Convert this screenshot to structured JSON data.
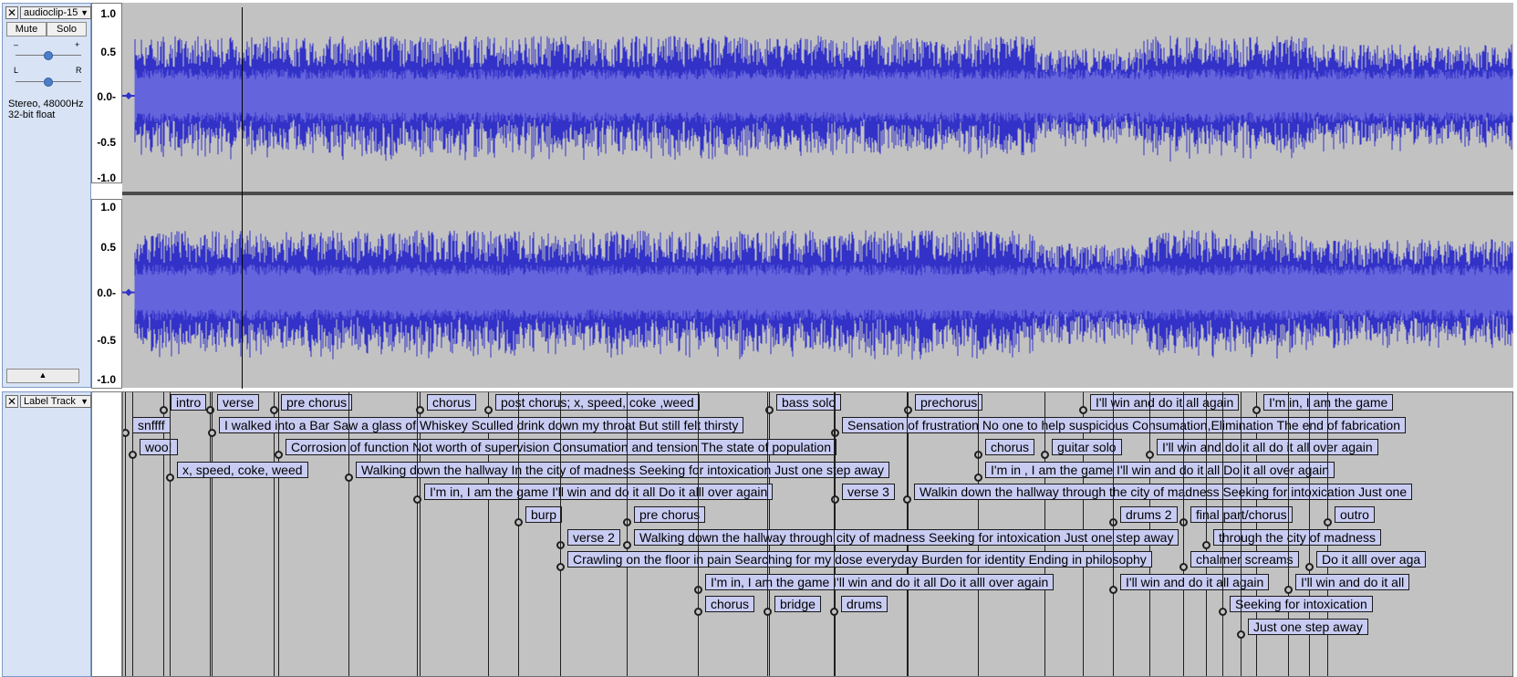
{
  "audio_track": {
    "name": "audioclip-15",
    "mute_label": "Mute",
    "solo_label": "Solo",
    "gain_minus": "–",
    "gain_plus": "+",
    "pan_left": "L",
    "pan_right": "R",
    "format_line1": "Stereo, 48000Hz",
    "format_line2": "32-bit float",
    "gain_level": 0.5,
    "pan_level": 0.5,
    "channels": [
      {
        "ticks": [
          "1.0",
          "0.5",
          "0.0-",
          "-0.5",
          "-1.0"
        ]
      },
      {
        "ticks": [
          "1.0",
          "0.5",
          "0.0-",
          "-0.5",
          "-1.0"
        ]
      }
    ]
  },
  "label_track": {
    "name": "Label Track",
    "labels": [
      {
        "text": "intro",
        "row": 0,
        "start": 44,
        "box": false
      },
      {
        "text": "verse",
        "row": 0,
        "start": 95,
        "box": false
      },
      {
        "text": "pre chorus",
        "row": 0,
        "start": 165,
        "box": false
      },
      {
        "text": "chorus",
        "row": 0,
        "start": 325,
        "box": false
      },
      {
        "text": "post chorus; x, speed, coke ,weed",
        "row": 0,
        "start": 400,
        "box": false
      },
      {
        "text": "bass solo",
        "row": 0,
        "start": 708,
        "box": false
      },
      {
        "text": "prechorus",
        "row": 0,
        "start": 860,
        "box": false
      },
      {
        "text": "I'll win and do it all again",
        "row": 0,
        "start": 1052,
        "box": false
      },
      {
        "text": "I'm in, I am the game",
        "row": 0,
        "start": 1242,
        "box": false
      },
      {
        "text": "snffff",
        "row": 1,
        "start": 2,
        "box": false
      },
      {
        "text": "I walked into a Bar  Saw a glass of Whiskey Sculled drink down my throat But still felt thirsty",
        "row": 1,
        "start": 97,
        "box": false
      },
      {
        "text": "Sensation of frustration No one to help suspicious Consumation,Elimination The end of fabrication",
        "row": 1,
        "start": 780,
        "box": false
      },
      {
        "text": "woo!",
        "row": 2,
        "start": 10,
        "box": false
      },
      {
        "text": "Corrosion of function Not worth of supervision Consumation and tension The state of population",
        "row": 2,
        "start": 170,
        "box": false
      },
      {
        "text": "chorus",
        "row": 2,
        "start": 937,
        "box": false
      },
      {
        "text": "guitar solo",
        "row": 2,
        "start": 1010,
        "box": false
      },
      {
        "text": "I'll win and do it all do it all over again",
        "row": 2,
        "start": 1125,
        "box": false
      },
      {
        "text": "x, speed, coke, weed",
        "row": 3,
        "start": 51,
        "box": false
      },
      {
        "text": "Walking down the hallway In the city of madness Seeking for intoxication Just one step away",
        "row": 3,
        "start": 247,
        "box": false
      },
      {
        "text": "I'm in , I am the game I'll win and do it all Do it all over again",
        "row": 3,
        "start": 937,
        "box": false
      },
      {
        "text": "I'm in, I am the game I'll win and do it all Do it alll over again",
        "row": 4,
        "start": 322,
        "box": false
      },
      {
        "text": "verse 3",
        "row": 4,
        "start": 780,
        "box": false
      },
      {
        "text": "Walkin down the hallway through the city of madness Seeking for intoxication Just one",
        "row": 4,
        "start": 859,
        "box": false
      },
      {
        "text": "burp",
        "row": 5,
        "start": 433,
        "box": false
      },
      {
        "text": "pre chorus",
        "row": 5,
        "start": 552,
        "box": false
      },
      {
        "text": "drums 2",
        "row": 5,
        "start": 1085,
        "box": false
      },
      {
        "text": "final part/chorus",
        "row": 5,
        "start": 1162,
        "box": false
      },
      {
        "text": "outro",
        "row": 5,
        "start": 1320,
        "box": false
      },
      {
        "text": "verse 2",
        "row": 6,
        "start": 479,
        "box": false
      },
      {
        "text": "Walking down the hallway through city of madness Seeking for intoxication Just one step away",
        "row": 6,
        "start": 552,
        "box": false
      },
      {
        "text": "through the city of madness",
        "row": 6,
        "start": 1187,
        "box": false
      },
      {
        "text": "Crawling on the floor in pain Searching for my dose everyday Burden for identity Ending in philosophy",
        "row": 7,
        "start": 479,
        "box": false
      },
      {
        "text": "chalmer screams",
        "row": 7,
        "start": 1162,
        "box": false
      },
      {
        "text": "Do it alll over aga",
        "row": 7,
        "start": 1300,
        "box": false
      },
      {
        "text": "I'm in, I am the game I'll win and do it all Do it alll over again",
        "row": 8,
        "start": 630,
        "box": false
      },
      {
        "text": "I'll win and do it all again",
        "row": 8,
        "start": 1085,
        "box": false
      },
      {
        "text": "I'll win and do it all",
        "row": 8,
        "start": 1277,
        "box": false
      },
      {
        "text": "chorus",
        "row": 9,
        "start": 630,
        "box": false
      },
      {
        "text": "bridge",
        "row": 9,
        "start": 706,
        "box": false
      },
      {
        "text": "drums",
        "row": 9,
        "start": 779,
        "box": false
      },
      {
        "text": "Seeking for intoxication",
        "row": 9,
        "start": 1205,
        "box": false
      },
      {
        "text": "Just one step away",
        "row": 10,
        "start": 1225,
        "box": false
      }
    ]
  },
  "colors": {
    "wave_dark": "#3232c8",
    "wave_light": "#6464dc",
    "label_fill": "#c8ccf2",
    "track_bg": "#c2c2c2"
  }
}
